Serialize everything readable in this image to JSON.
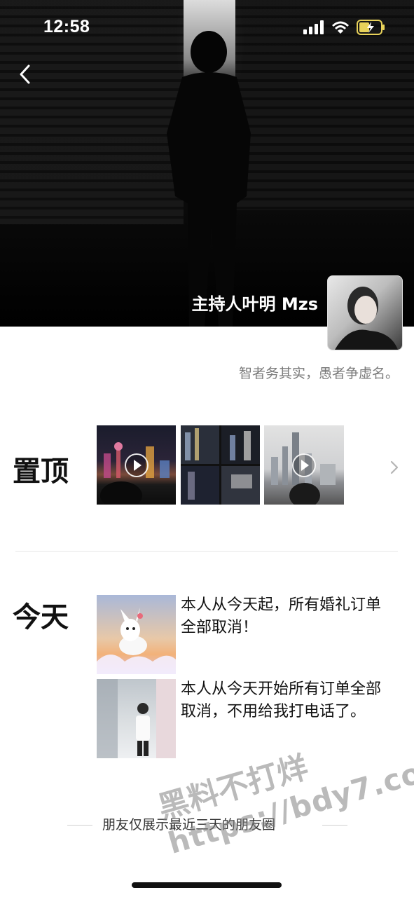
{
  "status_bar": {
    "time": "12:58",
    "icons": [
      "signal-icon",
      "wifi-icon",
      "battery-charging-icon"
    ]
  },
  "header": {
    "back_icon": "chevron-left-icon"
  },
  "profile": {
    "name": "主持人叶明 Mzs",
    "signature": "智者务其实，愚者争虚名。"
  },
  "pinned": {
    "label": "置顶",
    "items": [
      {
        "type": "video",
        "description": "city-night-video"
      },
      {
        "type": "image-grid",
        "description": "city-grid"
      },
      {
        "type": "video",
        "description": "skyline-video"
      }
    ],
    "more_icon": "chevron-right-icon"
  },
  "today": {
    "label": "今天",
    "posts": [
      {
        "text": "本人从今天起，所有婚礼订单全部取消！"
      },
      {
        "text": "本人从今天开始所有订单全部取消，不用给我打电话了。"
      }
    ]
  },
  "footer": {
    "text": "朋友仅展示最近三天的朋友圈"
  },
  "watermark": {
    "line1": "黑料不打烊",
    "line2": "https://bdy7.co"
  },
  "colors": {
    "text_primary": "#111111",
    "text_secondary": "#7a7a7a",
    "background": "#ffffff"
  }
}
